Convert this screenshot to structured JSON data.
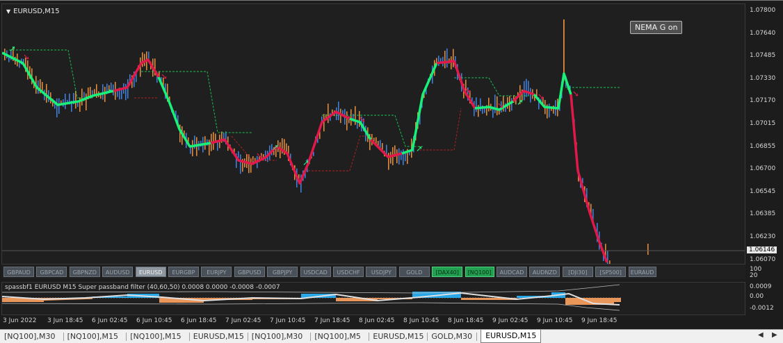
{
  "chart": {
    "symbol_title": "EURUSD,M15",
    "nema_button": "NEMA G on",
    "current_price": "1.06146",
    "price_labels": [
      "1.07800",
      "1.07640",
      "1.07485",
      "1.07330",
      "1.07170",
      "1.07015",
      "1.06855",
      "1.06700",
      "1.06545",
      "1.06385",
      "1.06230",
      "1.06070"
    ],
    "colors": {
      "background": "#1f1f1f",
      "up_candle": "#3f7fd9",
      "down_candle": "#e08a3c",
      "trend_up": "#19f07a",
      "trend_down": "#e0194a",
      "stop_up": "#19c050",
      "stop_down": "#b02020"
    }
  },
  "symbol_buttons": [
    {
      "label": "GBPAUD",
      "state": "normal"
    },
    {
      "label": "GBPCAD",
      "state": "normal"
    },
    {
      "label": "GBPNZD",
      "state": "normal"
    },
    {
      "label": "AUDUSD",
      "state": "normal"
    },
    {
      "label": "EURUSD",
      "state": "active"
    },
    {
      "label": "EURGBP",
      "state": "normal"
    },
    {
      "label": "EURJPY",
      "state": "normal"
    },
    {
      "label": "GBPUSD",
      "state": "normal"
    },
    {
      "label": "GBPJPY",
      "state": "normal"
    },
    {
      "label": "USDCAD",
      "state": "normal"
    },
    {
      "label": "USDCHF",
      "state": "normal"
    },
    {
      "label": "USDJPY",
      "state": "normal"
    },
    {
      "label": "GOLD",
      "state": "normal"
    },
    {
      "label": "[DAX40]",
      "state": "green"
    },
    {
      "label": "[NQ100]",
      "state": "green"
    },
    {
      "label": "AUDCAD",
      "state": "normal"
    },
    {
      "label": "AUDNZD",
      "state": "normal"
    },
    {
      "label": "[DJI30]",
      "state": "normal"
    },
    {
      "label": "[SP500]",
      "state": "normal"
    },
    {
      "label": "EURAUD",
      "state": "normal"
    }
  ],
  "subwindow": {
    "title": "spassbf1 EURUSD M15 Super passband filter (40,60,50) 0.0008 0.0000 -0.0008 -0.0007",
    "scale_labels": [
      "100",
      "20",
      "0.0009",
      "0.00",
      "-0.0012"
    ]
  },
  "time_labels": [
    "3 Jun 2022",
    "3 Jun 18:45",
    "6 Jun 02:45",
    "6 Jun 10:45",
    "6 Jun 18:45",
    "7 Jun 02:45",
    "7 Jun 10:45",
    "7 Jun 18:45",
    "8 Jun 02:45",
    "8 Jun 10:45",
    "8 Jun 18:45",
    "9 Jun 02:45",
    "9 Jun 10:45",
    "9 Jun 18:45"
  ],
  "tabs": [
    {
      "label": "[NQ100],M30",
      "active": false
    },
    {
      "label": "[NQ100],M15",
      "active": false
    },
    {
      "label": "[NQ100],M15",
      "active": false
    },
    {
      "label": "EURUSD,M15",
      "active": false
    },
    {
      "label": "[NQ100],M30",
      "active": false
    },
    {
      "label": "[NQ100],M5",
      "active": false
    },
    {
      "label": "EURUSD,M15",
      "active": false
    },
    {
      "label": "GOLD,M30",
      "active": false
    },
    {
      "label": "EURUSD,M15",
      "active": true
    }
  ],
  "scroll": {
    "left_icon": "scroll-left-icon",
    "right_icon": "scroll-right-icon"
  }
}
